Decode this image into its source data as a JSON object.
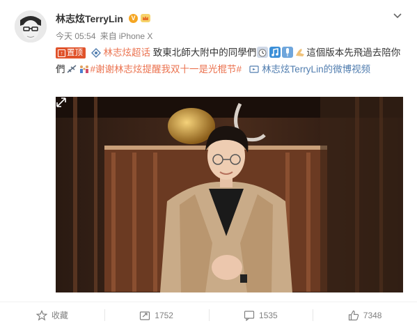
{
  "post": {
    "author": "林志炫TerryLin",
    "verified_badge": "V",
    "time": "今天 05:54",
    "source_prefix": "来自",
    "source": "iPhone X",
    "pin_label": "置顶",
    "supertopic_link": "林志炫超话",
    "text_part1": " 致東北師大附中的同學們",
    "text_part2": "這個版本先飛過去陪你們",
    "hashtag": "#谢谢林志炫提醒我双十一是光棍节#",
    "video_link": "林志炫TerryLin的微博视频"
  },
  "actions": {
    "favorite_label": "收藏",
    "repost_count": "1752",
    "comment_count": "1535",
    "like_count": "7348"
  },
  "colors": {
    "link": "#eb7350",
    "pin_bg": "#e0532b",
    "muted": "#808080"
  },
  "icons": [
    "chevron-down-icon",
    "crown-icon",
    "supertopic-icon",
    "alarm-clock-emoji",
    "music-note-emoji",
    "microphone-emoji",
    "praying-hands-emoji",
    "airplane-emoji",
    "family-emoji",
    "video-icon",
    "fullscreen-icon",
    "star-icon",
    "repost-icon",
    "comment-icon",
    "thumbs-up-icon"
  ]
}
